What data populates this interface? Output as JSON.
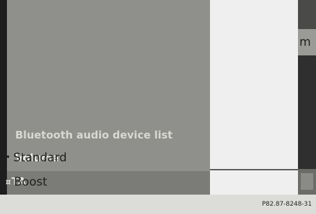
{
  "menu": {
    "items": [
      {
        "label": "Bluetooth audio device list"
      },
      {
        "label": "Volume"
      }
    ],
    "ta_label": "TA",
    "ta_icon": "checkbox-mark-icon"
  },
  "dropdown": {
    "options": [
      {
        "label": "Standard",
        "selected": true
      },
      {
        "label": "Boost",
        "selected": false
      }
    ],
    "bullet_icon": "bullet-icon"
  },
  "right_strip": {
    "partial_text": "m"
  },
  "caption": "P82.87-8248-31"
}
